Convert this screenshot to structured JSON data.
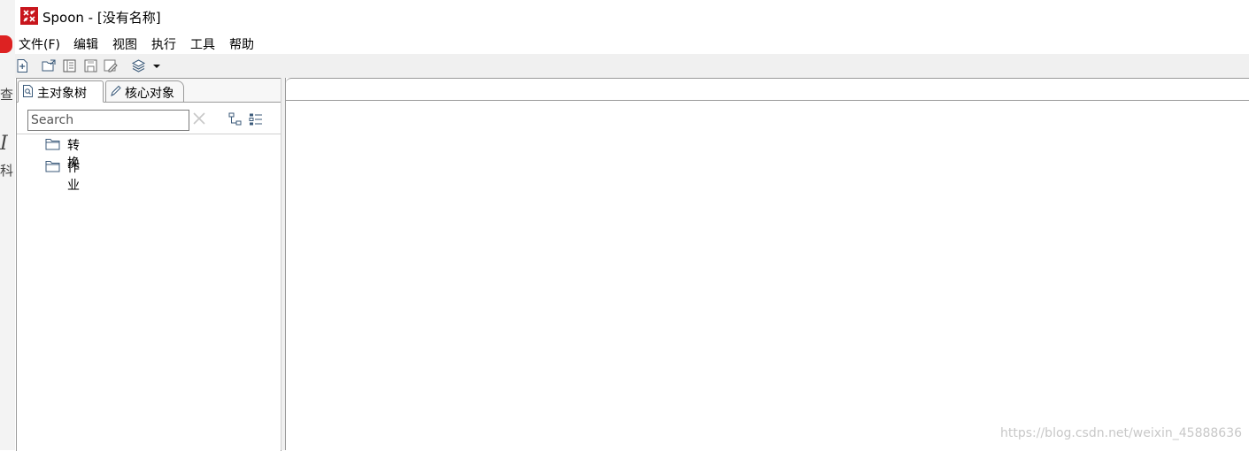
{
  "background_app": {
    "partial_glyphs": [
      "查",
      "I",
      "科"
    ]
  },
  "window": {
    "title": "Spoon - [没有名称]",
    "icon": "spoon-app-icon",
    "accent_color": "#c8161d"
  },
  "menu": {
    "items": [
      "文件(F)",
      "编辑",
      "视图",
      "执行",
      "工具",
      "帮助"
    ]
  },
  "toolbar": {
    "icons": [
      "new-file-icon",
      "open-file-icon",
      "explore-repository-icon",
      "save-icon",
      "save-as-icon",
      "perspective-layers-icon",
      "dropdown-arrow-icon"
    ]
  },
  "left_panel": {
    "tabs": [
      {
        "label": "主对象树",
        "icon": "search-doc-icon",
        "active": true
      },
      {
        "label": "核心对象",
        "icon": "pencil-icon",
        "active": false
      }
    ],
    "search": {
      "placeholder": "Search",
      "value": ""
    },
    "tree": [
      {
        "label": "转换",
        "icon": "folder-icon"
      },
      {
        "label": "作业",
        "icon": "folder-icon"
      }
    ]
  },
  "watermark": "https://blog.csdn.net/weixin_45888636"
}
